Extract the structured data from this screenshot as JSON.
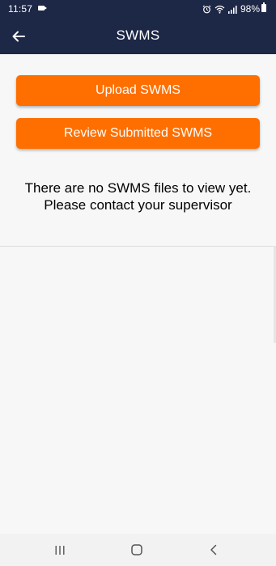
{
  "status_bar": {
    "time": "11:57",
    "battery_text": "98%",
    "battery_level": 0.98,
    "icons": [
      "video-camera-icon",
      "alarm-icon",
      "wifi-icon",
      "signal-icon",
      "battery-icon"
    ]
  },
  "app_bar": {
    "title": "SWMS",
    "back_icon": "arrow-left-icon"
  },
  "actions": {
    "upload_label": "Upload SWMS",
    "review_label": "Review Submitted SWMS"
  },
  "message": {
    "line1": "There are no SWMS files to view yet.",
    "line2": "Please contact your supervisor"
  },
  "nav": {
    "icons": [
      "recents-icon",
      "home-icon",
      "back-icon"
    ]
  },
  "colors": {
    "app_bar": "#1d2746",
    "button": "#ff6f00",
    "background": "#f7f7f7"
  }
}
